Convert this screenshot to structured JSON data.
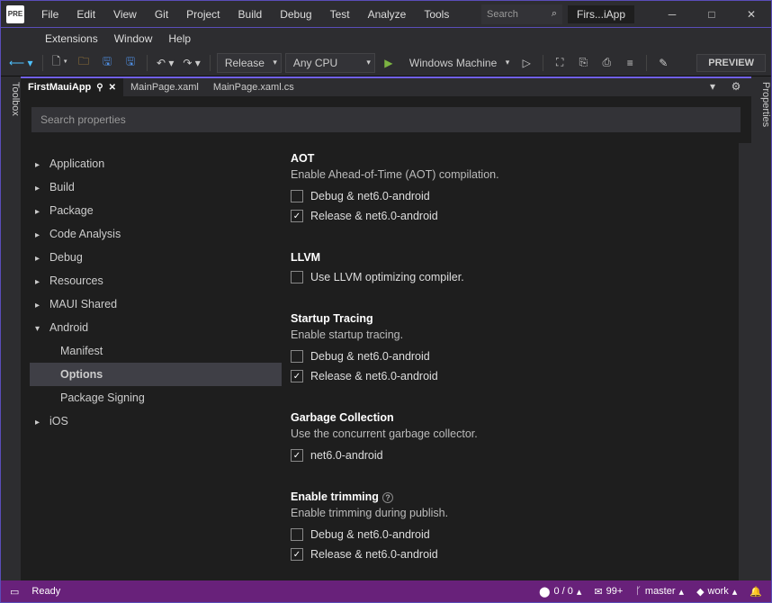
{
  "title": {
    "app_short": "Firs...iApp"
  },
  "menu": [
    "File",
    "Edit",
    "View",
    "Git",
    "Project",
    "Build",
    "Debug",
    "Test",
    "Analyze",
    "Tools",
    "Extensions",
    "Window",
    "Help"
  ],
  "search_placeholder": "Search",
  "toolbar": {
    "config": "Release",
    "platform": "Any CPU",
    "target": "Windows Machine",
    "preview": "PREVIEW"
  },
  "sidebars": {
    "left": "Toolbox",
    "right": "Properties"
  },
  "tabs": [
    {
      "label": "FirstMauiApp",
      "active": true,
      "pinned": true,
      "closable": true
    },
    {
      "label": "MainPage.xaml",
      "active": false
    },
    {
      "label": "MainPage.xaml.cs",
      "active": false
    }
  ],
  "search_props_placeholder": "Search properties",
  "tree": [
    {
      "label": "Application",
      "expandable": true
    },
    {
      "label": "Build",
      "expandable": true
    },
    {
      "label": "Package",
      "expandable": true
    },
    {
      "label": "Code Analysis",
      "expandable": true
    },
    {
      "label": "Debug",
      "expandable": true
    },
    {
      "label": "Resources",
      "expandable": true
    },
    {
      "label": "MAUI Shared",
      "expandable": true
    },
    {
      "label": "Android",
      "expandable": true,
      "expanded": true,
      "children": [
        {
          "label": "Manifest"
        },
        {
          "label": "Options",
          "selected": true
        },
        {
          "label": "Package Signing"
        }
      ]
    },
    {
      "label": "iOS",
      "expandable": true
    }
  ],
  "sections": [
    {
      "title": "AOT",
      "desc": "Enable Ahead-of-Time (AOT) compilation.",
      "checks": [
        {
          "label": "Debug & net6.0-android",
          "checked": false
        },
        {
          "label": "Release & net6.0-android",
          "checked": true
        }
      ]
    },
    {
      "title": "LLVM",
      "desc": "",
      "checks": [
        {
          "label": "Use LLVM optimizing compiler.",
          "checked": false
        }
      ]
    },
    {
      "title": "Startup Tracing",
      "desc": "Enable startup tracing.",
      "checks": [
        {
          "label": "Debug & net6.0-android",
          "checked": false
        },
        {
          "label": "Release & net6.0-android",
          "checked": true
        }
      ]
    },
    {
      "title": "Garbage Collection",
      "desc": "Use the concurrent garbage collector.",
      "checks": [
        {
          "label": "net6.0-android",
          "checked": true
        }
      ]
    },
    {
      "title": "Enable trimming",
      "help": true,
      "desc": "Enable trimming during publish.",
      "checks": [
        {
          "label": "Debug & net6.0-android",
          "checked": false
        },
        {
          "label": "Release & net6.0-android",
          "checked": true
        }
      ]
    }
  ],
  "status": {
    "ready": "Ready",
    "errors": "0 / 0",
    "msgs": "99+",
    "branch": "master",
    "work": "work"
  }
}
